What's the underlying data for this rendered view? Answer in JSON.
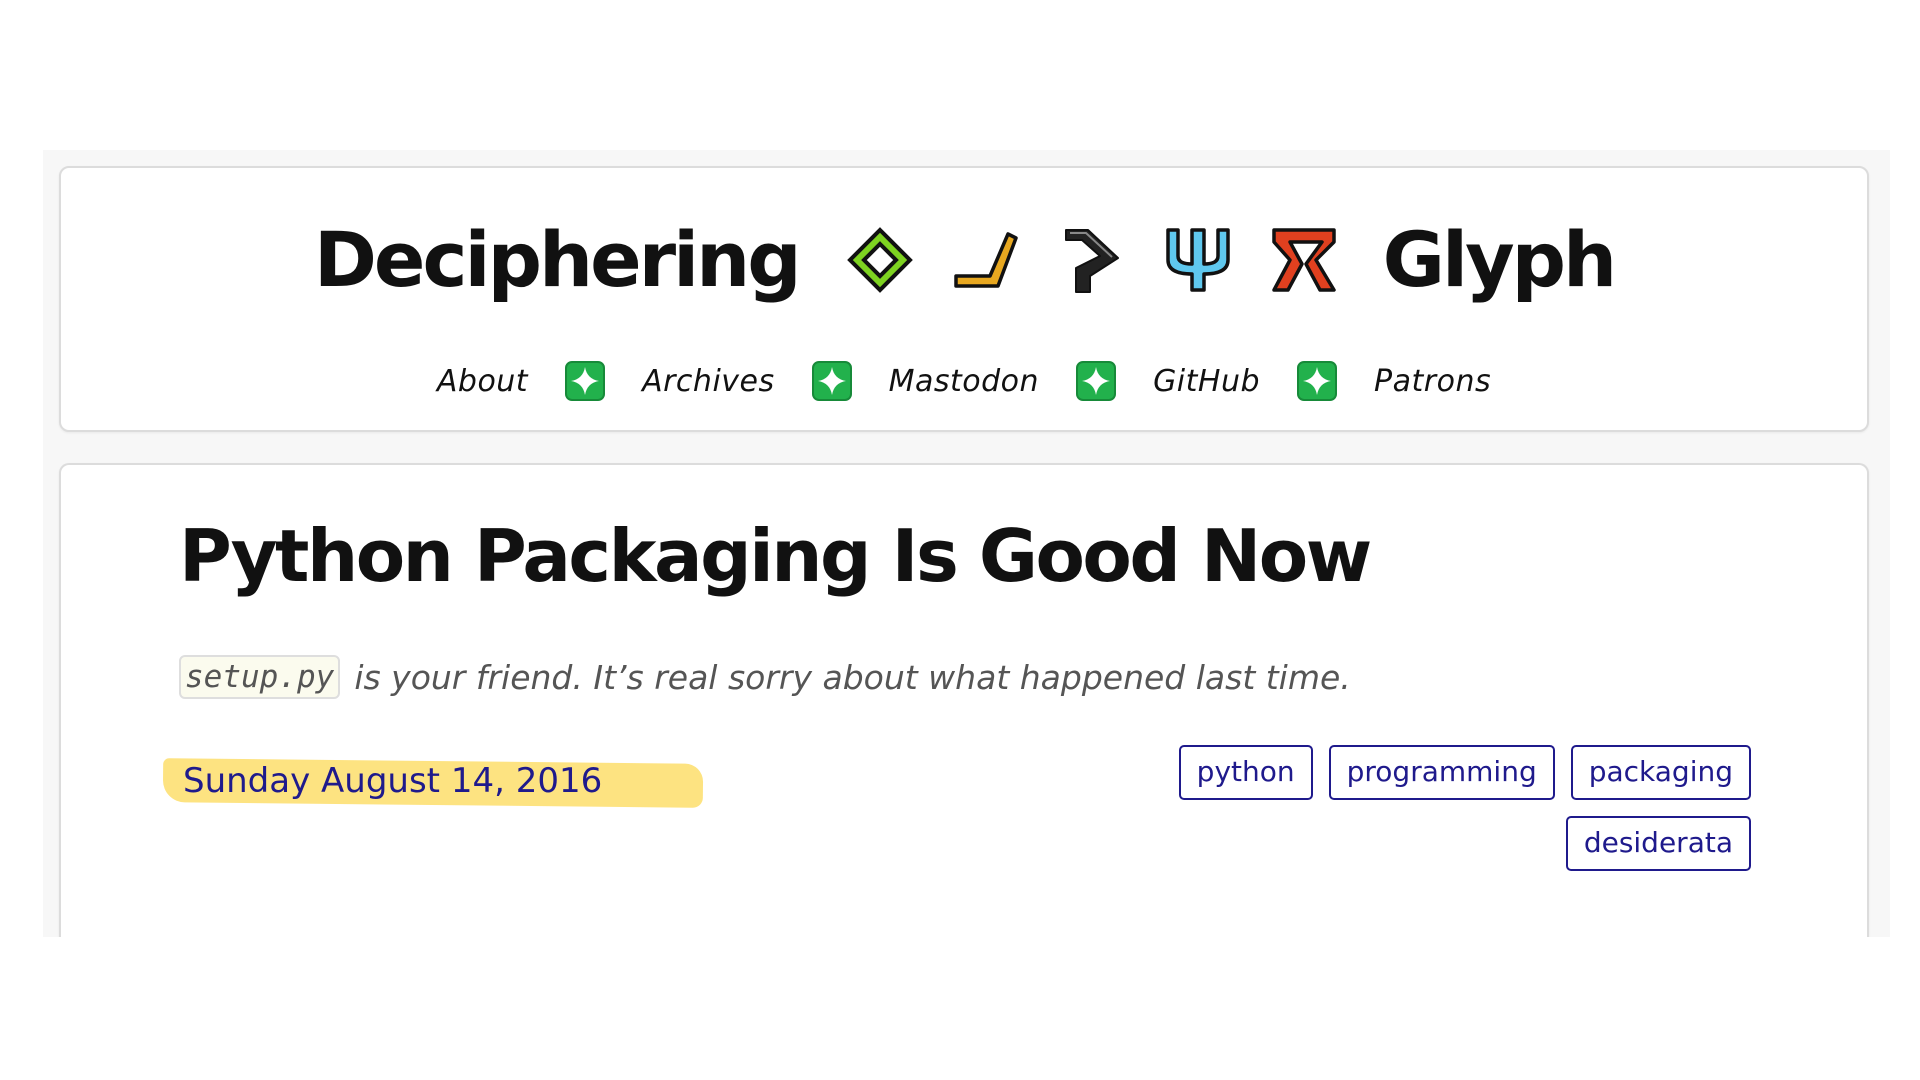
{
  "site": {
    "title_left": "Deciphering",
    "title_right": "Glyph",
    "glyph_icons": [
      "green-diamond-icon",
      "orange-check-icon",
      "black-angle-icon",
      "blue-trident-icon",
      "red-r-icon"
    ],
    "colors": {
      "diamond": "#7ed321",
      "check": "#e8a820",
      "angle": "#222222",
      "trident": "#5fc8ee",
      "rune": "#e0401f",
      "sparkle_box": "#22b14c"
    }
  },
  "nav": {
    "items": [
      {
        "label": "About"
      },
      {
        "label": "Archives"
      },
      {
        "label": "Mastodon"
      },
      {
        "label": "GitHub"
      },
      {
        "label": "Patrons"
      }
    ],
    "separator_icon": "sparkle-icon"
  },
  "post": {
    "title": "Python Packaging Is Good Now",
    "subtitle_code": "setup.py",
    "subtitle_text": "is your friend. It’s real sorry about what happened last time.",
    "date": "Sunday August 14, 2016",
    "tags": [
      "python",
      "programming",
      "packaging",
      "desiderata"
    ]
  },
  "theme": {
    "link_color": "#1f1a8c",
    "highlight_color": "#fde27a"
  }
}
